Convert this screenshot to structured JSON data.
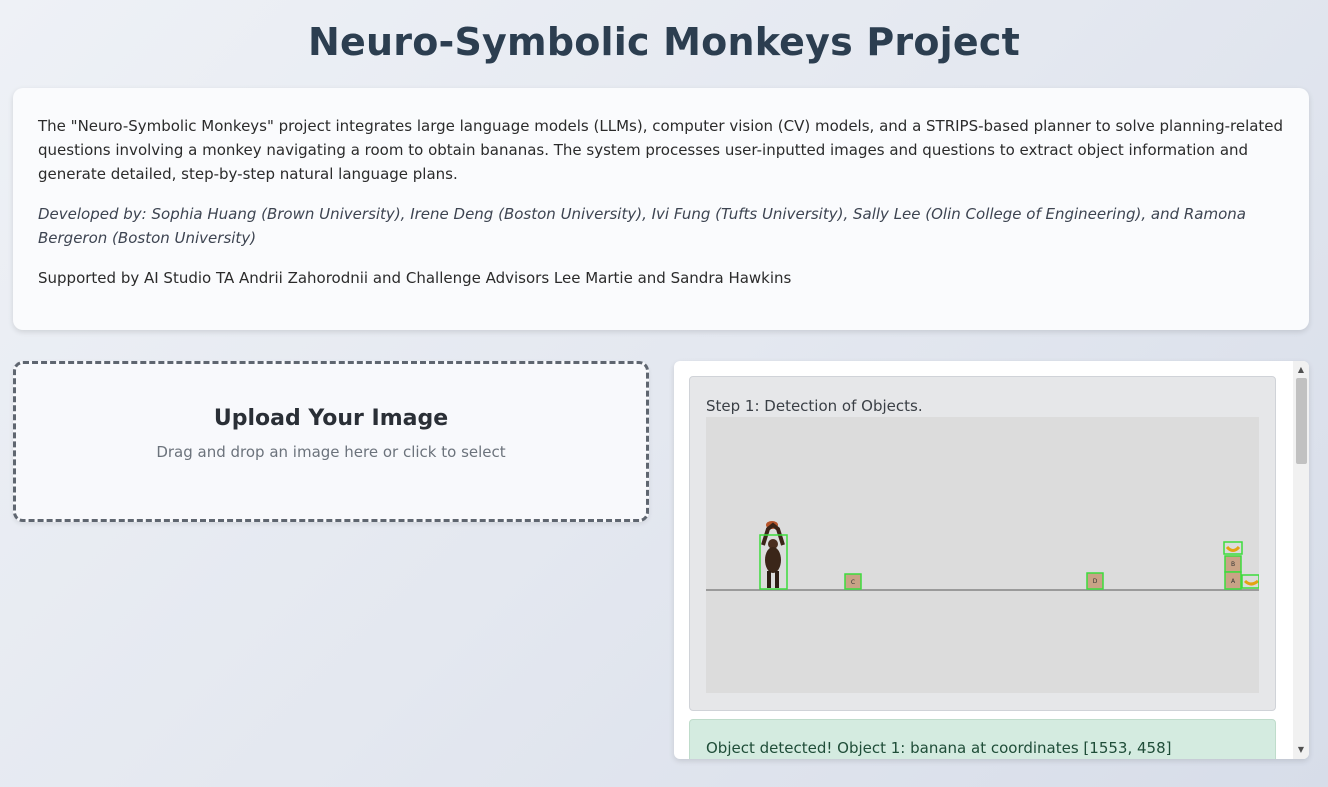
{
  "header": {
    "title": "Neuro-Symbolic Monkeys Project"
  },
  "info": {
    "description": "The \"Neuro-Symbolic Monkeys\" project integrates large language models (LLMs), computer vision (CV) models, and a STRIPS-based planner to solve planning-related questions involving a monkey navigating a room to obtain bananas. The system processes user-inputted images and questions to extract object information and generate detailed, step-by-step natural language plans.",
    "developed_by": "Developed by: Sophia Huang (Brown University), Irene Deng (Boston University), Ivi Fung (Tufts University), Sally Lee (Olin College of Engineering), and Ramona Bergeron (Boston University)",
    "supported_by": "Supported by AI Studio TA Andrii Zahorodnii and Challenge Advisors Lee Martie and Sandra Hawkins"
  },
  "upload": {
    "title": "Upload Your Image",
    "subtitle": "Drag and drop an image here or click to select"
  },
  "results": {
    "step1_label": "Step 1: Detection of Objects.",
    "detected_message": "Object detected! Object 1: banana at coordinates [1553, 458]",
    "scene": {
      "box_labels": {
        "c": "C",
        "d": "D",
        "b": "B",
        "a": "A"
      }
    }
  },
  "colors": {
    "title": "#2c3e50",
    "detection_box": "#3ddc3d",
    "success_bg": "#d4ebe0",
    "box_fill": "#c9a386"
  },
  "icons": {
    "scroll_up": "triangle-up",
    "scroll_down": "triangle-down"
  }
}
